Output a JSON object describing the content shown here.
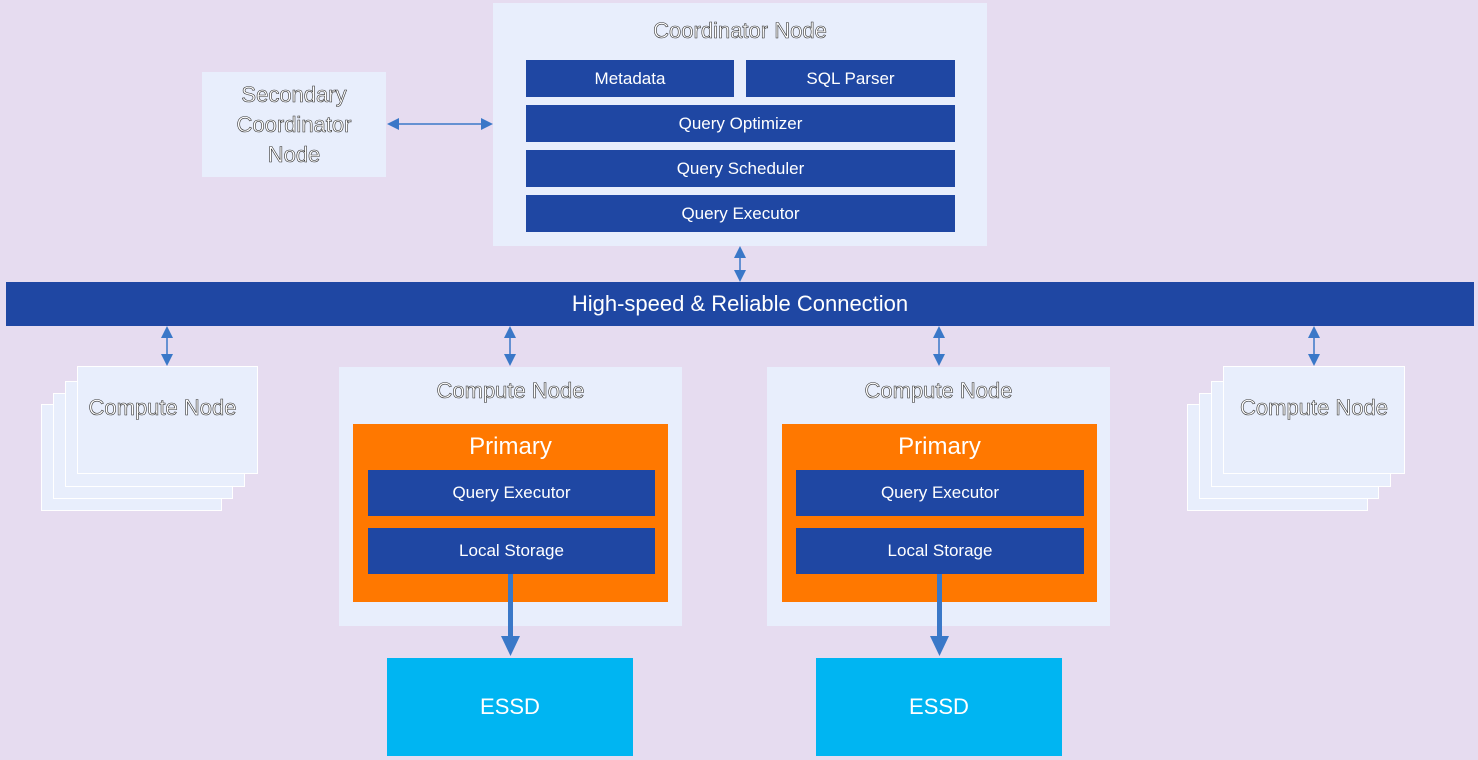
{
  "coordinator": {
    "title": "Coordinator Node",
    "modules": [
      "Metadata",
      "SQL Parser",
      "Query Optimizer",
      "Query Scheduler",
      "Query Executor"
    ]
  },
  "secondary": {
    "title": "Secondary Coordinator Node"
  },
  "connection": {
    "label": "High-speed & Reliable Connection"
  },
  "compute_stacked": {
    "label": "Compute Node"
  },
  "compute_nodes": [
    {
      "title": "Compute Node",
      "primary": "Primary",
      "executor": "Query Executor",
      "storage": "Local Storage",
      "disk": "ESSD"
    },
    {
      "title": "Compute Node",
      "primary": "Primary",
      "executor": "Query Executor",
      "storage": "Local Storage",
      "disk": "ESSD"
    }
  ],
  "colors": {
    "module": "#1f47a3",
    "primary": "#ff7800",
    "essd": "#00b5f2",
    "arrow": "#3a78c8"
  }
}
